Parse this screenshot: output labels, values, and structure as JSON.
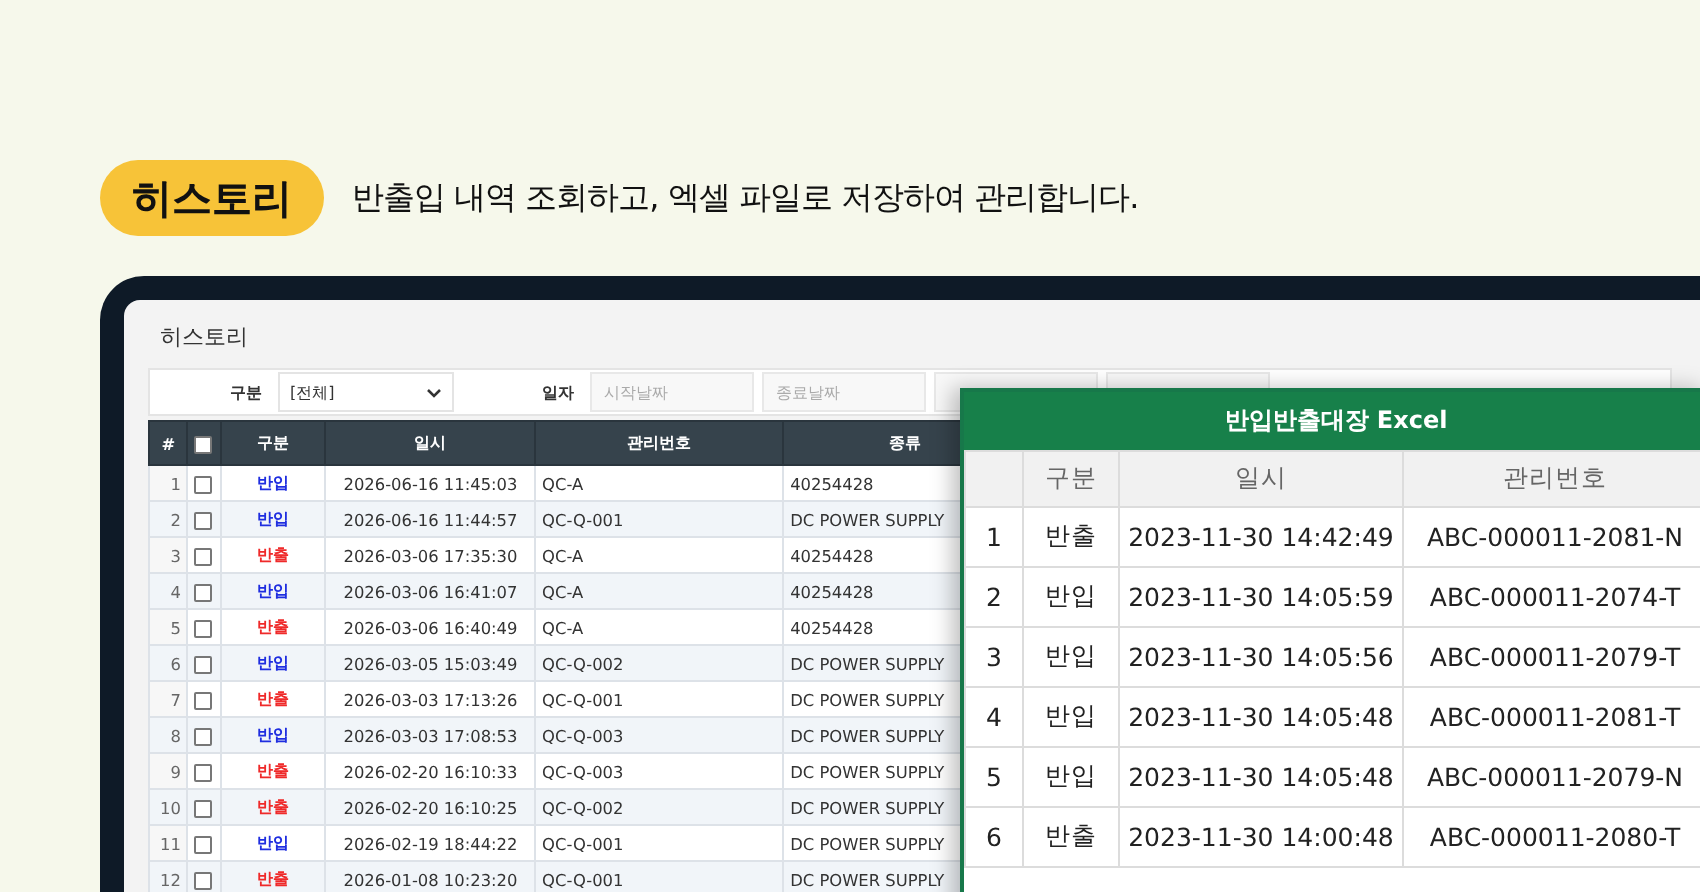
{
  "badge": "히스토리",
  "subtitle": "반출입 내역 조회하고, 엑셀 파일로 저장하여 관리합니다.",
  "panel": {
    "title": "히스토리",
    "filters": {
      "type_label": "구분",
      "type_value": "[전체]",
      "date_label": "일자",
      "start_placeholder": "시작날짜",
      "end_placeholder": "종료날짜"
    },
    "table": {
      "columns": [
        "#",
        "구분",
        "일시",
        "관리번호",
        "종류"
      ],
      "header_checked": false,
      "rows": [
        {
          "no": "1",
          "checked": false,
          "kind": "in",
          "type": "반입",
          "time": "2026-06-16 11:45:03",
          "code": "QC-A",
          "category": "40254428"
        },
        {
          "no": "2",
          "checked": false,
          "kind": "in",
          "type": "반입",
          "time": "2026-06-16 11:44:57",
          "code": "QC-Q-001",
          "category": "DC POWER SUPPLY"
        },
        {
          "no": "3",
          "checked": false,
          "kind": "out",
          "type": "반출",
          "time": "2026-03-06 17:35:30",
          "code": "QC-A",
          "category": "40254428"
        },
        {
          "no": "4",
          "checked": false,
          "kind": "in",
          "type": "반입",
          "time": "2026-03-06 16:41:07",
          "code": "QC-A",
          "category": "40254428"
        },
        {
          "no": "5",
          "checked": false,
          "kind": "out",
          "type": "반출",
          "time": "2026-03-06 16:40:49",
          "code": "QC-A",
          "category": "40254428"
        },
        {
          "no": "6",
          "checked": false,
          "kind": "in",
          "type": "반입",
          "time": "2026-03-05 15:03:49",
          "code": "QC-Q-002",
          "category": "DC POWER SUPPLY"
        },
        {
          "no": "7",
          "checked": false,
          "kind": "out",
          "type": "반출",
          "time": "2026-03-03 17:13:26",
          "code": "QC-Q-001",
          "category": "DC POWER SUPPLY"
        },
        {
          "no": "8",
          "checked": false,
          "kind": "in",
          "type": "반입",
          "time": "2026-03-03 17:08:53",
          "code": "QC-Q-003",
          "category": "DC POWER SUPPLY"
        },
        {
          "no": "9",
          "checked": false,
          "kind": "out",
          "type": "반출",
          "time": "2026-02-20 16:10:33",
          "code": "QC-Q-003",
          "category": "DC POWER SUPPLY"
        },
        {
          "no": "10",
          "checked": false,
          "kind": "out",
          "type": "반출",
          "time": "2026-02-20 16:10:25",
          "code": "QC-Q-002",
          "category": "DC POWER SUPPLY"
        },
        {
          "no": "11",
          "checked": false,
          "kind": "in",
          "type": "반입",
          "time": "2026-02-19 18:44:22",
          "code": "QC-Q-001",
          "category": "DC POWER SUPPLY"
        },
        {
          "no": "12",
          "checked": false,
          "kind": "out",
          "type": "반출",
          "time": "2026-01-08 10:23:20",
          "code": "QC-Q-001",
          "category": "DC POWER SUPPLY"
        }
      ]
    }
  },
  "excel": {
    "title": "반입반출대장 Excel",
    "columns": [
      "구분",
      "일시",
      "관리번호"
    ],
    "rows": [
      {
        "no": "1",
        "type": "반출",
        "time": "2023-11-30 14:42:49",
        "code": "ABC-000011-2081-N"
      },
      {
        "no": "2",
        "type": "반입",
        "time": "2023-11-30 14:05:59",
        "code": "ABC-000011-2074-T"
      },
      {
        "no": "3",
        "type": "반입",
        "time": "2023-11-30 14:05:56",
        "code": "ABC-000011-2079-T"
      },
      {
        "no": "4",
        "type": "반입",
        "time": "2023-11-30 14:05:48",
        "code": "ABC-000011-2081-T"
      },
      {
        "no": "5",
        "type": "반입",
        "time": "2023-11-30 14:05:48",
        "code": "ABC-000011-2079-N"
      },
      {
        "no": "6",
        "type": "반출",
        "time": "2023-11-30 14:00:48",
        "code": "ABC-000011-2080-T"
      }
    ]
  }
}
